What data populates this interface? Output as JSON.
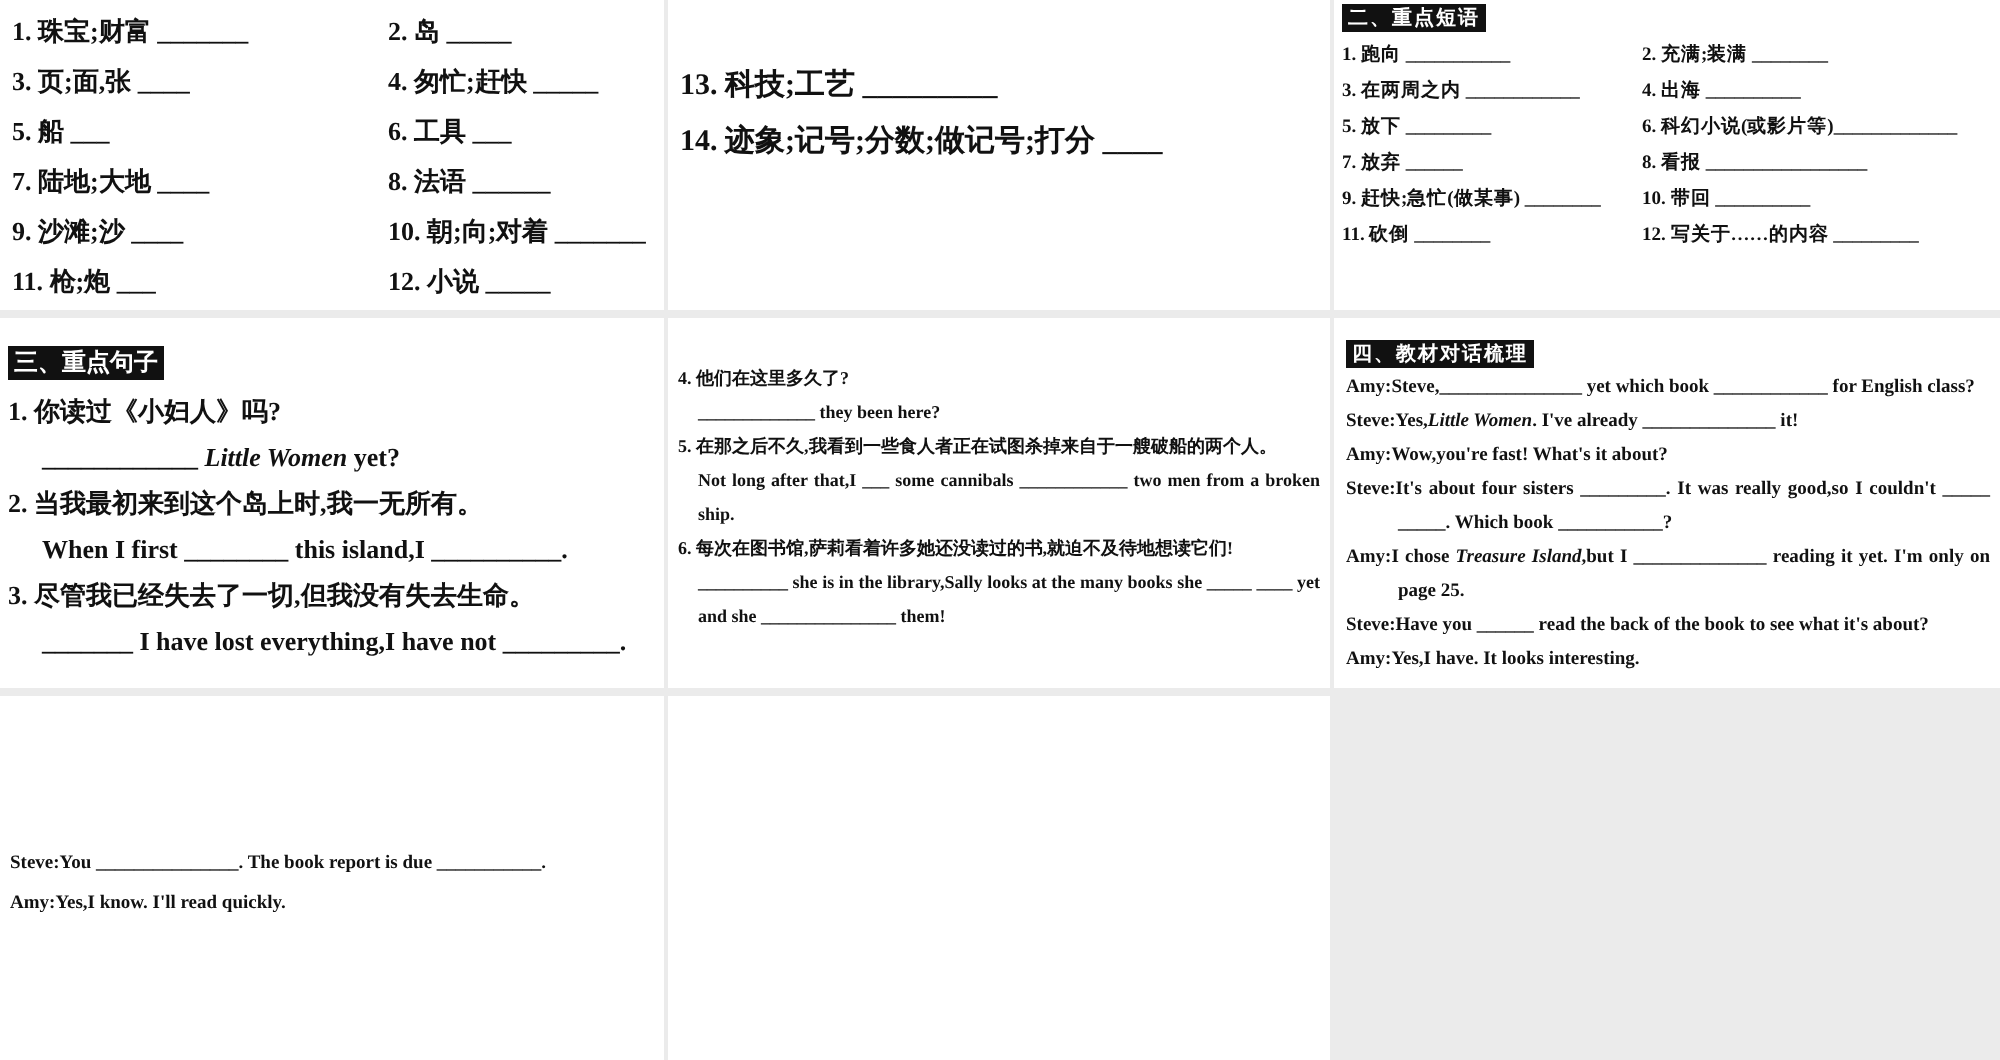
{
  "slides": [
    {
      "kind": "vocab-grid",
      "items": [
        "1. 珠宝;财富 _______",
        "2. 岛 _____",
        "3. 页;面,张 ____",
        "4. 匆忙;赶快 _____",
        "5. 船 ___",
        "6. 工具 ___",
        "7. 陆地;大地 ____",
        "8. 法语 ______",
        "9. 沙滩;沙 ____",
        "10. 朝;向;对着 _______",
        "11. 枪;炮 ___",
        "12. 小说 _____"
      ]
    },
    {
      "kind": "vocab-list",
      "lines": [
        "13. 科技;工艺 _________",
        "14. 迹象;记号;分数;做记号;打分 ____"
      ]
    },
    {
      "kind": "phrase-grid",
      "heading": "二、重点短语",
      "items": [
        "1. 跑向 ___________",
        "2. 充满;装满 ________",
        "3. 在两周之内 ____________",
        "4. 出海 __________",
        "5. 放下 _________",
        "6. 科幻小说(或影片等)_____________",
        "7. 放弃 ______",
        "8. 看报 _________________",
        "9. 赶快;急忙(做某事) ________",
        "10. 带回 __________",
        "11. 砍倒 ________",
        "12. 写关于……的内容 _________"
      ]
    },
    {
      "kind": "sentence-list",
      "heading": "三、重点句子",
      "lines": [
        {
          "text": "1. 你读过《小妇人》吗?",
          "indented": false
        },
        {
          "text": "____________ *Little Women* yet?",
          "indented": true
        },
        {
          "text": "2. 当我最初来到这个岛上时,我一无所有。",
          "indented": false
        },
        {
          "text": "When I first ________ this island,I __________.",
          "indented": true
        },
        {
          "text": "3. 尽管我已经失去了一切,但我没有失去生命。",
          "indented": false
        },
        {
          "text": "_______ I have lost everything,I have not _________.",
          "indented": true
        }
      ]
    },
    {
      "kind": "sentence-list-small",
      "lines": [
        {
          "text": "4. 他们在这里多久了?",
          "indented": false
        },
        {
          "text": "_____________ they been here?",
          "indented": true
        },
        {
          "text": "5. 在那之后不久,我看到一些食人者正在试图杀掉来自于一艘破船的两个人。",
          "indented": false
        },
        {
          "text": "Not long after that,I ___ some cannibals ____________ two men from a broken ship.",
          "indented": true
        },
        {
          "text": "6. 每次在图书馆,萨莉看着许多她还没读过的书,就迫不及待地想读它们!",
          "indented": false
        },
        {
          "text": "__________ she is in the library,Sally looks at the many books she _____ ____ yet and she _______________ them!",
          "indented": true
        }
      ]
    },
    {
      "kind": "dialogue",
      "heading": "四、教材对话梳理",
      "lines": [
        "Amy:Steve,_______________ yet which book ____________ for English class?",
        "Steve:Yes,*Little Women*. I've already ______________ it!",
        "Amy:Wow,you're fast! What's it about?",
        "Steve:It's about four sisters _________. It was really good,so I couldn't _____ _____. Which book ___________?",
        "Amy:I chose *Treasure Island*,but I ______________ reading it yet. I'm only on page 25.",
        "Steve:Have you ______ read the back of the book to see what it's about?",
        "Amy:Yes,I have. It looks interesting."
      ]
    },
    {
      "kind": "dialogue-end",
      "lines": [
        "Steve:You _______________. The book report is due ___________.",
        "Amy:Yes,I know. I'll read quickly."
      ]
    },
    {
      "kind": "empty"
    }
  ]
}
